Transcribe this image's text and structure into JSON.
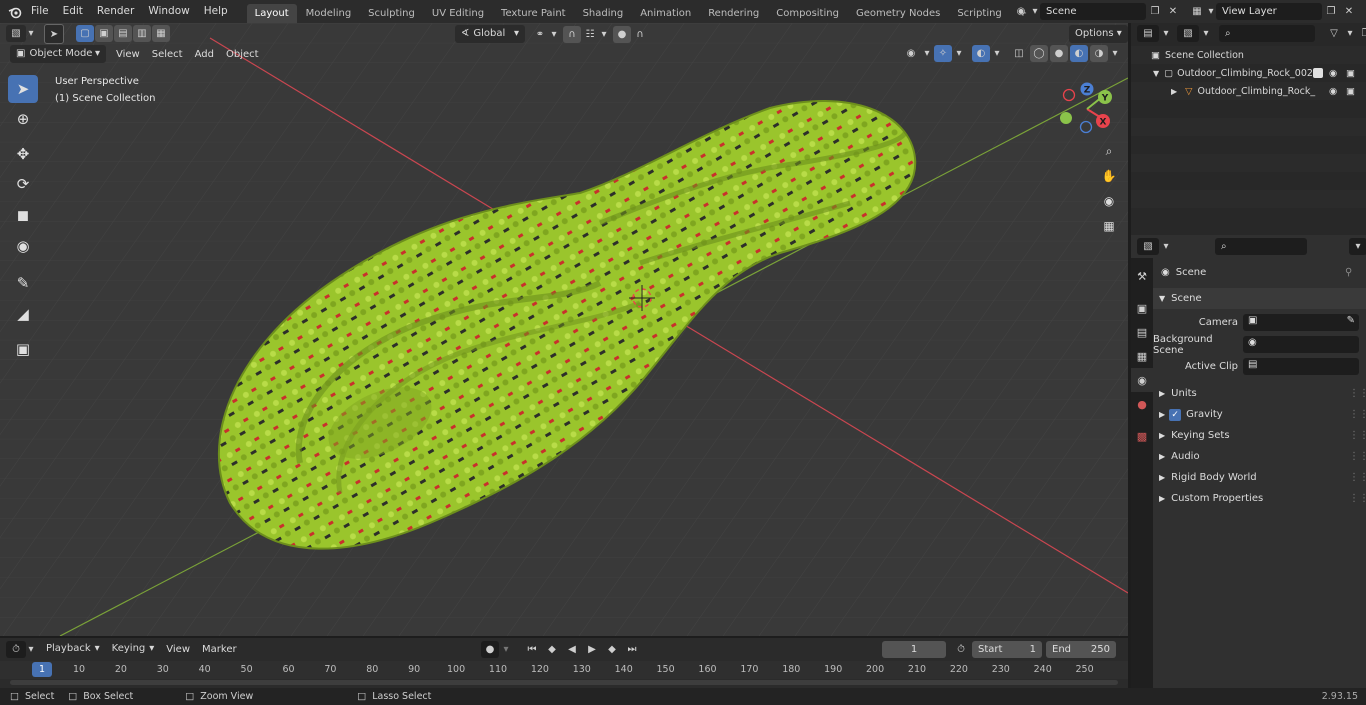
{
  "menubar": {
    "items": [
      "File",
      "Edit",
      "Render",
      "Window",
      "Help"
    ],
    "workspaces": [
      "Layout",
      "Modeling",
      "Sculpting",
      "UV Editing",
      "Texture Paint",
      "Shading",
      "Animation",
      "Rendering",
      "Compositing",
      "Geometry Nodes",
      "Scripting"
    ],
    "active_workspace": "Layout",
    "add_tab": "+",
    "scene_name": "Scene",
    "view_layer": "View Layer"
  },
  "viewport": {
    "mode": "Object Mode",
    "menus": [
      "View",
      "Select",
      "Add",
      "Object"
    ],
    "transform_orientation": "Global",
    "options_label": "Options",
    "overlay_text_1": "User Perspective",
    "overlay_text_2": "(1) Scene Collection",
    "gizmo_axes": {
      "x": "X",
      "y": "Y",
      "z": "Z"
    },
    "tools": [
      "select-box-icon",
      "cursor-icon",
      "move-icon",
      "rotate-icon",
      "scale-icon",
      "transform-icon",
      "annotate-icon",
      "measure-icon",
      "add-cube-icon"
    ],
    "nav_buttons": [
      "zoom-icon",
      "pan-hand-icon",
      "camera-icon",
      "grid-icon"
    ]
  },
  "outliner": {
    "search_placeholder": "",
    "root": "Scene Collection",
    "collection": "Outdoor_Climbing_Rock_002",
    "object": "Outdoor_Climbing_Rock_"
  },
  "properties": {
    "search_placeholder": "",
    "breadcrumb": "Scene",
    "panel_title": "Scene",
    "fields": [
      {
        "label": "Camera"
      },
      {
        "label": "Background Scene"
      },
      {
        "label": "Active Clip"
      }
    ],
    "subpanels": [
      "Units",
      "Gravity",
      "Keying Sets",
      "Audio",
      "Rigid Body World",
      "Custom Properties"
    ],
    "gravity_checked": true
  },
  "timeline": {
    "menus": [
      "Playback",
      "Keying",
      "View",
      "Marker"
    ],
    "current_frame": "1",
    "start_label": "Start",
    "start_value": "1",
    "end_label": "End",
    "end_value": "250",
    "ruler_labels": [
      "1",
      "10",
      "20",
      "30",
      "40",
      "50",
      "60",
      "70",
      "80",
      "90",
      "100",
      "110",
      "120",
      "130",
      "140",
      "150",
      "160",
      "170",
      "180",
      "190",
      "200",
      "210",
      "220",
      "230",
      "240",
      "250"
    ]
  },
  "statusbar": {
    "select": "Select",
    "box_select": "Box Select",
    "zoom_view": "Zoom View",
    "lasso_select": "Lasso Select",
    "version": "2.93.15"
  },
  "colors": {
    "accent": "#4772b3",
    "x_axis": "#e8434c",
    "y_axis": "#8bc34a",
    "z_axis": "#4b7fd4",
    "rope_green": "#9ac52c",
    "rope_red": "#d0322d"
  }
}
